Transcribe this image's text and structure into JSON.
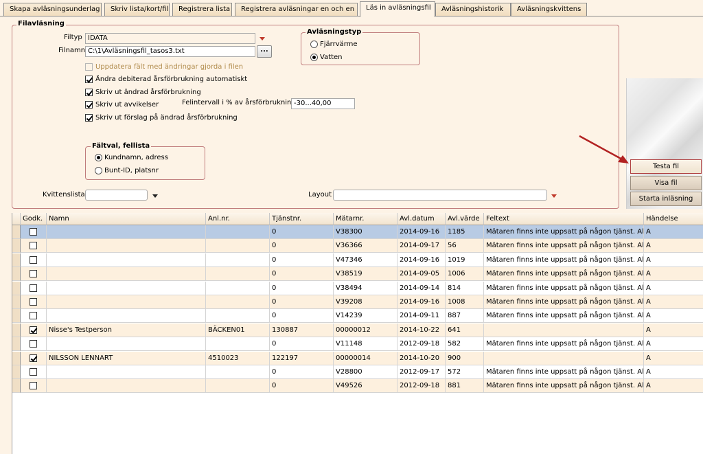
{
  "tabs": [
    {
      "label": "Skapa avläsningsunderlag",
      "active": false
    },
    {
      "label": "Skriv lista/kort/fil",
      "active": false
    },
    {
      "label": "Registrera lista",
      "active": false
    },
    {
      "label": "Registrera avläsningar en och en",
      "active": false
    },
    {
      "label": "Läs in avläsningsfil",
      "active": true
    },
    {
      "label": "Avläsningshistorik",
      "active": false
    },
    {
      "label": "Avläsningskvittens",
      "active": false
    }
  ],
  "filavlasning": {
    "title": "Filavläsning",
    "filtyp_label": "Filtyp",
    "filtyp_value": "IDATA",
    "filnamn_label": "Filnamn",
    "filnamn_value": "C:\\1\\Avläsningsfil_tasos3.txt",
    "browse_label": "...",
    "checkboxes": [
      {
        "label": "Uppdatera fält med ändringar gjorda i filen",
        "checked": false,
        "disabled": true
      },
      {
        "label": "Ändra debiterad årsförbrukning automatiskt",
        "checked": true,
        "disabled": false
      },
      {
        "label": "Skriv ut ändrad årsförbrukning",
        "checked": true,
        "disabled": false
      },
      {
        "label": "Skriv ut avvikelser",
        "checked": true,
        "disabled": false
      },
      {
        "label": "Skriv ut förslag på ändrad årsförbrukning",
        "checked": true,
        "disabled": false
      }
    ],
    "felintervall_label": "Felintervall i % av årsförbrukning",
    "felintervall_value": "-30...40,00",
    "avlasningstyp": {
      "title": "Avläsningstyp",
      "options": [
        {
          "label": "Fjärrvärme",
          "selected": false
        },
        {
          "label": "Vatten",
          "selected": true
        }
      ]
    },
    "faltval": {
      "title": "Fältval, fellista",
      "options": [
        {
          "label": "Kundnamn, adress",
          "selected": true
        },
        {
          "label": "Bunt-ID, platsnr",
          "selected": false
        }
      ]
    },
    "kvittenslista_label": "Kvittenslista",
    "kvittenslista_value": "",
    "layout_label": "Layout",
    "layout_value": ""
  },
  "actions": {
    "testa": "Testa fil",
    "visa": "Visa fil",
    "starta": "Starta inläsning"
  },
  "grid": {
    "columns": [
      "Godk.",
      "Namn",
      "Anl.nr.",
      "Tjänstnr.",
      "Mätarnr.",
      "Avl.datum",
      "Avl.värde",
      "Feltext",
      "Händelse"
    ],
    "rows": [
      {
        "godk": false,
        "namn": "",
        "anl": "",
        "tjanst": "0",
        "matar": "V38300",
        "datum": "2014-09-16",
        "varde": "1185",
        "feltext": "Mätaren finns inte uppsatt på någon tjänst. Altern...",
        "handelse": "A",
        "selected": true
      },
      {
        "godk": false,
        "namn": "",
        "anl": "",
        "tjanst": "0",
        "matar": "V36366",
        "datum": "2014-09-17",
        "varde": "56",
        "feltext": "Mätaren finns inte uppsatt på någon tjänst. Altern...",
        "handelse": "A",
        "selected": false
      },
      {
        "godk": false,
        "namn": "",
        "anl": "",
        "tjanst": "0",
        "matar": "V47346",
        "datum": "2014-09-16",
        "varde": "1019",
        "feltext": "Mätaren finns inte uppsatt på någon tjänst. Altern...",
        "handelse": "A",
        "selected": false
      },
      {
        "godk": false,
        "namn": "",
        "anl": "",
        "tjanst": "0",
        "matar": "V38519",
        "datum": "2014-09-05",
        "varde": "1006",
        "feltext": "Mätaren finns inte uppsatt på någon tjänst. Altern...",
        "handelse": "A",
        "selected": false
      },
      {
        "godk": false,
        "namn": "",
        "anl": "",
        "tjanst": "0",
        "matar": "V38494",
        "datum": "2014-09-14",
        "varde": "814",
        "feltext": "Mätaren finns inte uppsatt på någon tjänst. Altern...",
        "handelse": "A",
        "selected": false
      },
      {
        "godk": false,
        "namn": "",
        "anl": "",
        "tjanst": "0",
        "matar": "V39208",
        "datum": "2014-09-16",
        "varde": "1008",
        "feltext": "Mätaren finns inte uppsatt på någon tjänst. Altern...",
        "handelse": "A",
        "selected": false
      },
      {
        "godk": false,
        "namn": "",
        "anl": "",
        "tjanst": "0",
        "matar": "V14239",
        "datum": "2014-09-11",
        "varde": "887",
        "feltext": "Mätaren finns inte uppsatt på någon tjänst. Altern...",
        "handelse": "A",
        "selected": false
      },
      {
        "godk": true,
        "namn": "Nisse's Testperson",
        "anl": "BÄCKEN01",
        "tjanst": "130887",
        "matar": "00000012",
        "datum": "2014-10-22",
        "varde": "641",
        "feltext": "",
        "handelse": "A",
        "selected": false
      },
      {
        "godk": false,
        "namn": "",
        "anl": "",
        "tjanst": "0",
        "matar": "V11148",
        "datum": "2012-09-18",
        "varde": "582",
        "feltext": "Mätaren finns inte uppsatt på någon tjänst. Altern...",
        "handelse": "A",
        "selected": false
      },
      {
        "godk": true,
        "namn": "NILSSON LENNART",
        "anl": "4510023",
        "tjanst": "122197",
        "matar": "00000014",
        "datum": "2014-10-20",
        "varde": "900",
        "feltext": "",
        "handelse": "A",
        "selected": false
      },
      {
        "godk": false,
        "namn": "",
        "anl": "",
        "tjanst": "0",
        "matar": "V28800",
        "datum": "2012-09-17",
        "varde": "572",
        "feltext": "Mätaren finns inte uppsatt på någon tjänst. Altern...",
        "handelse": "A",
        "selected": false
      },
      {
        "godk": false,
        "namn": "",
        "anl": "",
        "tjanst": "0",
        "matar": "V49526",
        "datum": "2012-09-18",
        "varde": "881",
        "feltext": "Mätaren finns inte uppsatt på någon tjänst. Altern...",
        "handelse": "A",
        "selected": false
      }
    ]
  },
  "colors": {
    "background": "#fdf3e6",
    "groupbox_border": "#c07c7c",
    "row_alt": "#fdf0de",
    "row_selected": "#b8cbe4",
    "annotation_arrow": "#b22222"
  }
}
